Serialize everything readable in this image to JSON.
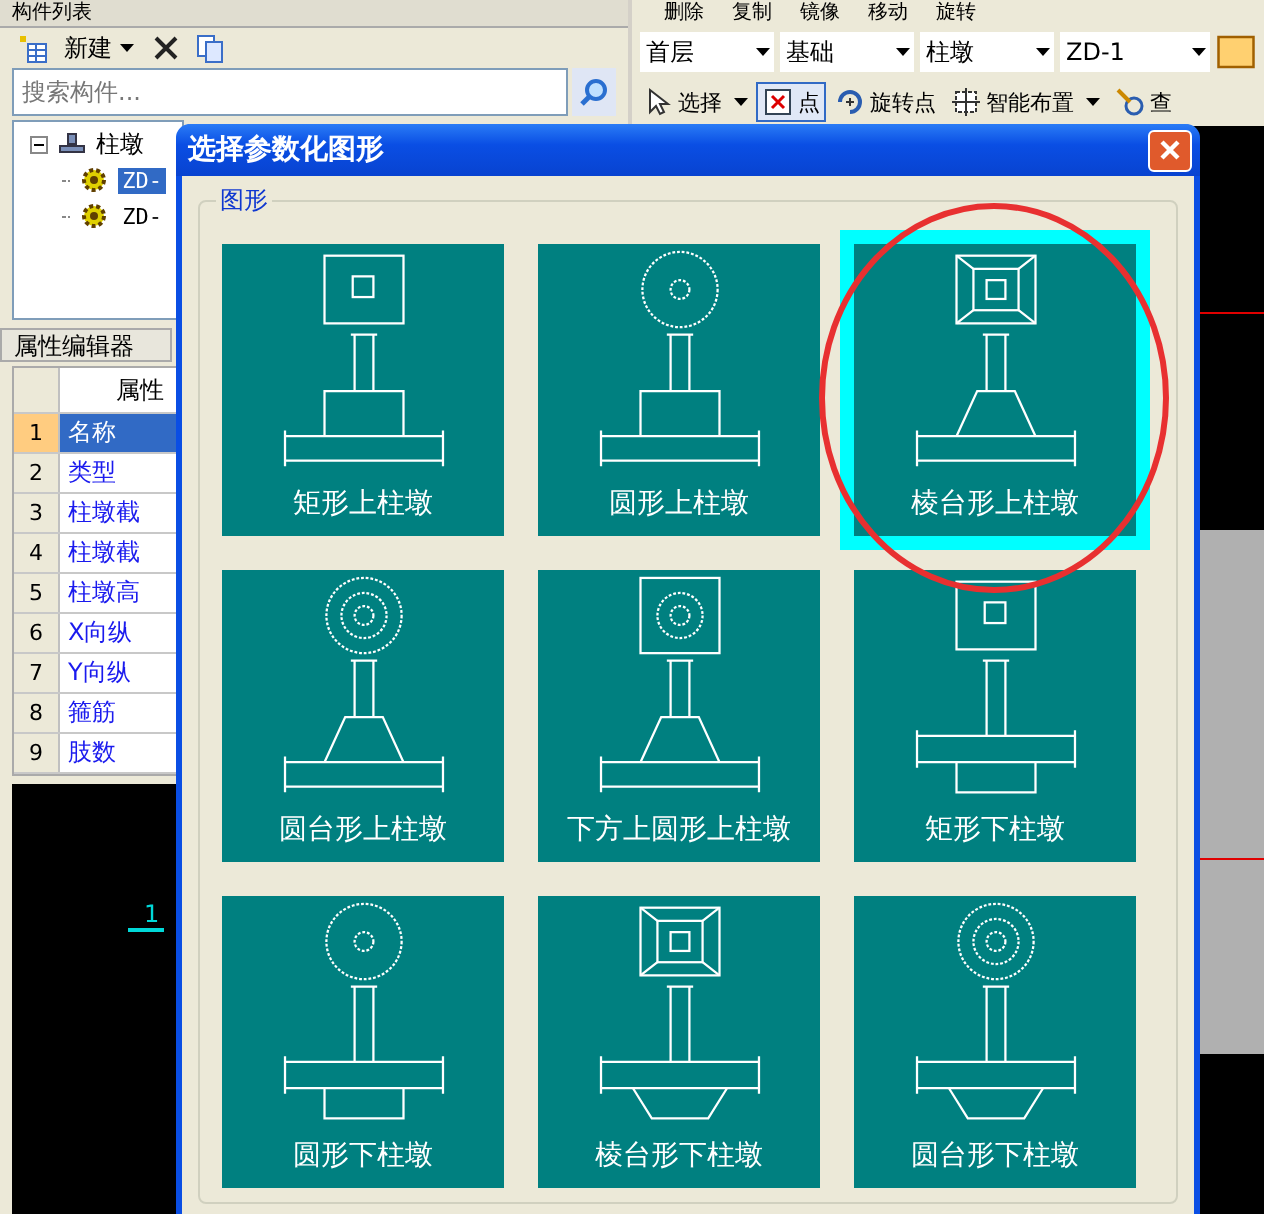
{
  "left_panel": {
    "title": "构件列表",
    "new_label": "新建",
    "search": {
      "placeholder": "搜索构件..."
    },
    "tree": [
      {
        "label": "柱墩",
        "expanded": true,
        "children": [
          {
            "label": "ZD-",
            "selected": true
          },
          {
            "label": "ZD-",
            "selected": false
          }
        ]
      }
    ],
    "property_editor": {
      "title": "属性编辑器",
      "column_header": "属性",
      "rows": [
        {
          "index": "1",
          "name": "名称",
          "selected": true
        },
        {
          "index": "2",
          "name": "类型",
          "selected": false
        },
        {
          "index": "3",
          "name": "柱墩截",
          "selected": false
        },
        {
          "index": "4",
          "name": "柱墩截",
          "selected": false
        },
        {
          "index": "5",
          "name": "柱墩高",
          "selected": false
        },
        {
          "index": "6",
          "name": "X向纵",
          "selected": false
        },
        {
          "index": "7",
          "name": "Y向纵",
          "selected": false
        },
        {
          "index": "8",
          "name": "箍筋",
          "selected": false
        },
        {
          "index": "9",
          "name": "肢数",
          "selected": false
        }
      ]
    },
    "canvas_label": "1"
  },
  "edit_toolbar": [
    "删除",
    "复制",
    "镜像",
    "移动",
    "旋转"
  ],
  "selectors": [
    "首层",
    "基础",
    "柱墩",
    "ZD-1"
  ],
  "draw_toolbar": [
    {
      "label": "选择",
      "dropdown": true,
      "pressed": false
    },
    {
      "label": "点",
      "dropdown": false,
      "pressed": true
    },
    {
      "label": "旋转点",
      "dropdown": false,
      "pressed": false
    },
    {
      "label": "智能布置",
      "dropdown": true,
      "pressed": false
    },
    {
      "label": "查",
      "dropdown": false,
      "pressed": false
    }
  ],
  "dialog": {
    "title": "选择参数化图形",
    "group_label": "图形",
    "shapes": [
      {
        "label": "矩形上柱墩",
        "selected": false
      },
      {
        "label": "圆形上柱墩",
        "selected": false
      },
      {
        "label": "棱台形上柱墩",
        "selected": true
      },
      {
        "label": "圆台形上柱墩",
        "selected": false
      },
      {
        "label": "下方上圆形上柱墩",
        "selected": false
      },
      {
        "label": "矩形下柱墩",
        "selected": false
      },
      {
        "label": "圆形下柱墩",
        "selected": false
      },
      {
        "label": "棱台形下柱墩",
        "selected": false
      },
      {
        "label": "圆台形下柱墩",
        "selected": false
      }
    ]
  }
}
